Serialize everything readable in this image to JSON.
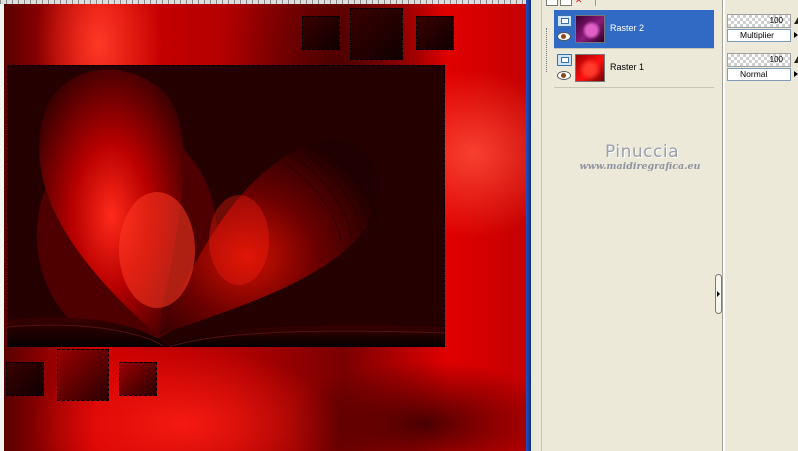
{
  "layers": [
    {
      "name": "Raster 2",
      "selected": true,
      "opacity": "100",
      "blend_mode": "Multiplier",
      "thumbnail": "magenta-heart-thumbnail"
    },
    {
      "name": "Raster 1",
      "selected": false,
      "opacity": "100",
      "blend_mode": "Normal",
      "thumbnail": "red-heart-thumbnail"
    }
  ],
  "watermark": {
    "title": "Pinuccia",
    "url": "www.maidiregrafica.eu"
  },
  "icons": {
    "toolbar": [
      "new-layer-icon",
      "delete-layer-icon",
      "layer-options-icon"
    ],
    "row": [
      "raster-layer-icon",
      "visibility-eye-icon"
    ],
    "panel": "collapse-arrow-icon"
  },
  "colors": {
    "selection_highlight": "#316ac5",
    "canvas_red": "#d30000",
    "canvas_dark": "#140000",
    "panel_background": "#ece9d8",
    "delete_icon": "#d01010"
  }
}
